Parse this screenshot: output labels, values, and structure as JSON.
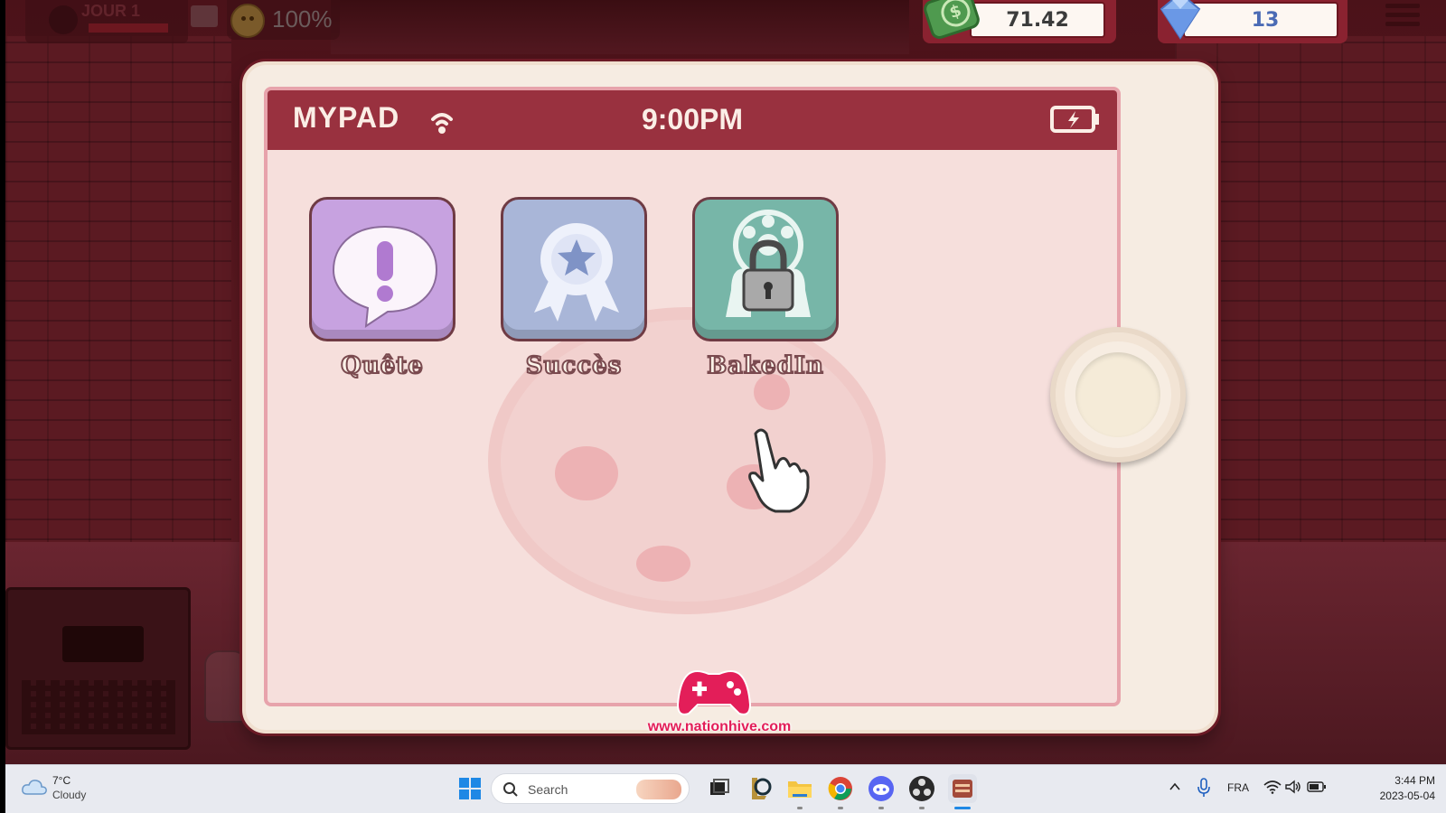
{
  "hud": {
    "day_label": "JOUR 1",
    "mood_percent": "100%",
    "money": "71.42",
    "gems": "13"
  },
  "mypad": {
    "brand": "MYPAD",
    "clock": "9:00PM",
    "apps": [
      {
        "label": "Quête",
        "icon": "exclamation-bubble-icon",
        "locked": false
      },
      {
        "label": "Succès",
        "icon": "award-ribbon-icon",
        "locked": false
      },
      {
        "label": "BakedIn",
        "icon": "network-lock-icon",
        "locked": true
      }
    ]
  },
  "watermark": {
    "url": "www.nationhive.com"
  },
  "taskbar": {
    "weather_temp": "7°C",
    "weather_condition": "Cloudy",
    "search_placeholder": "Search",
    "language": "FRA",
    "time": "3:44 PM",
    "date": "2023-05-04"
  },
  "colors": {
    "status_bar": "#99313f",
    "screen_bg": "#f6dfdc",
    "quete_tile": "#c7a2e0",
    "succes_tile": "#a9b6d8",
    "bakedin_tile": "#77b6a8",
    "watermark": "#e31e59"
  }
}
